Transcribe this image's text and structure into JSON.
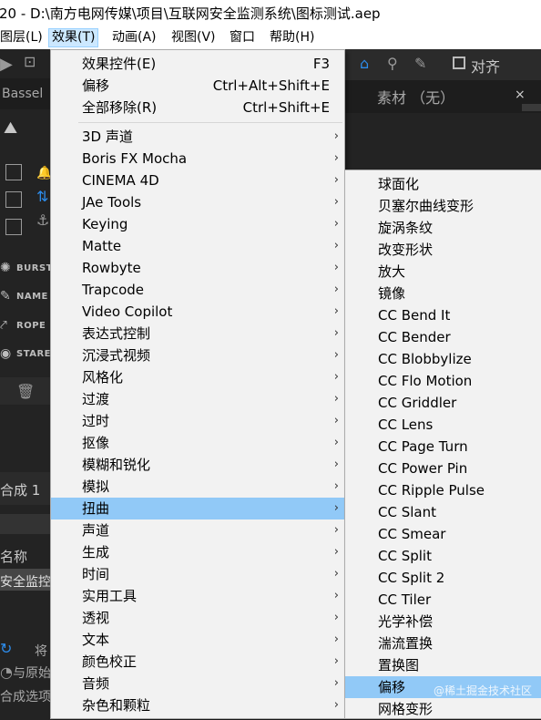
{
  "window": {
    "title": "20 - D:\\南方电网传媒\\项目\\互联网安全监测系统\\图标测试.aep"
  },
  "menubar": {
    "items": [
      {
        "label": "图层(L)"
      },
      {
        "label": "效果(T)"
      },
      {
        "label": "动画(A)"
      },
      {
        "label": "视图(V)"
      },
      {
        "label": "窗口"
      },
      {
        "label": "帮助(H)"
      }
    ]
  },
  "background": {
    "plugin_label": "Bassel",
    "align_label": "对齐",
    "footage_label": "素材 （无）",
    "left_labels": [
      "BURST",
      "NAME",
      "ROPE",
      "STARE"
    ],
    "comp_tab": "合成 1",
    "name_header": "名称",
    "layer_name": "安全监控",
    "bottom_1": "将",
    "bottom_2": "与原始",
    "bottom_3": "合成选项",
    "accent_color": "#2d8ceb"
  },
  "effects_menu": {
    "top_items": [
      {
        "label": "效果控件(E)",
        "shortcut": "F3"
      },
      {
        "label": "偏移",
        "shortcut": "Ctrl+Alt+Shift+E"
      },
      {
        "label": "全部移除(R)",
        "shortcut": "Ctrl+Shift+E"
      }
    ],
    "categories": [
      {
        "label": "3D 声道"
      },
      {
        "label": "Boris FX Mocha"
      },
      {
        "label": "CINEMA 4D"
      },
      {
        "label": "JAe Tools"
      },
      {
        "label": "Keying"
      },
      {
        "label": "Matte"
      },
      {
        "label": "Rowbyte"
      },
      {
        "label": "Trapcode"
      },
      {
        "label": "Video Copilot"
      },
      {
        "label": "表达式控制"
      },
      {
        "label": "沉浸式视频"
      },
      {
        "label": "风格化"
      },
      {
        "label": "过渡"
      },
      {
        "label": "过时"
      },
      {
        "label": "抠像"
      },
      {
        "label": "模糊和锐化"
      },
      {
        "label": "模拟"
      },
      {
        "label": "扭曲",
        "highlighted": true
      },
      {
        "label": "声道"
      },
      {
        "label": "生成"
      },
      {
        "label": "时间"
      },
      {
        "label": "实用工具"
      },
      {
        "label": "透视"
      },
      {
        "label": "文本"
      },
      {
        "label": "颜色校正"
      },
      {
        "label": "音频"
      },
      {
        "label": "杂色和颗粒"
      }
    ],
    "highlight_color": "#91c9f7"
  },
  "distort_menu": {
    "items": [
      {
        "label": "球面化"
      },
      {
        "label": "贝塞尔曲线变形"
      },
      {
        "label": "旋涡条纹"
      },
      {
        "label": "改变形状"
      },
      {
        "label": "放大"
      },
      {
        "label": "镜像"
      },
      {
        "label": "CC Bend It"
      },
      {
        "label": "CC Bender"
      },
      {
        "label": "CC Blobbylize"
      },
      {
        "label": "CC Flo Motion"
      },
      {
        "label": "CC Griddler"
      },
      {
        "label": "CC Lens"
      },
      {
        "label": "CC Page Turn"
      },
      {
        "label": "CC Power Pin"
      },
      {
        "label": "CC Ripple Pulse"
      },
      {
        "label": "CC Slant"
      },
      {
        "label": "CC Smear"
      },
      {
        "label": "CC Split"
      },
      {
        "label": "CC Split 2"
      },
      {
        "label": "CC Tiler"
      },
      {
        "label": "光学补偿"
      },
      {
        "label": "湍流置换"
      },
      {
        "label": "置换图"
      },
      {
        "label": "偏移",
        "highlighted": true
      },
      {
        "label": "网格变形"
      }
    ]
  },
  "watermark": "@稀土掘金技术社区"
}
